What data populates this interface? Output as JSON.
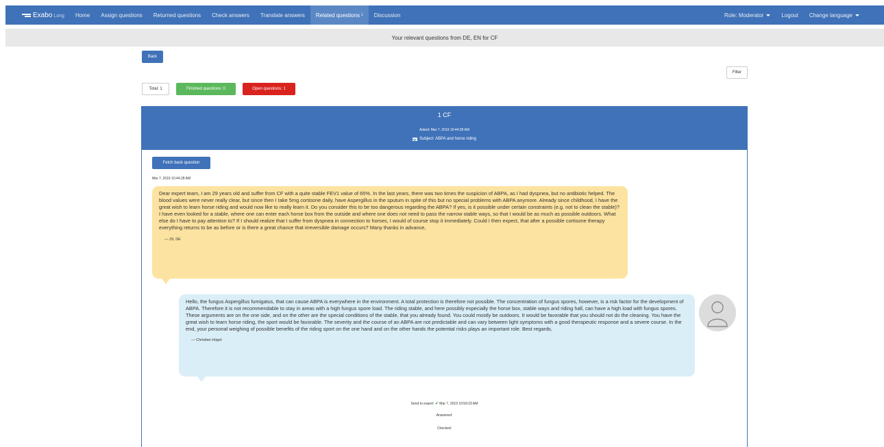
{
  "navbar": {
    "brand": "Exabo",
    "brand_sub": "Long",
    "items": [
      {
        "label": "Home"
      },
      {
        "label": "Assign questions"
      },
      {
        "label": "Returned questions"
      },
      {
        "label": "Check answers"
      },
      {
        "label": "Translate answers"
      },
      {
        "label": "Related questions",
        "badge": "1"
      },
      {
        "label": "Discussion"
      }
    ],
    "role": "Role: Moderator",
    "logout": "Logout",
    "change_language": "Change language"
  },
  "subheader": "Your relevant questions from DE, EN for CF",
  "buttons": {
    "back": "Back",
    "filter": "Filter",
    "fetch_back": "Fetch back question"
  },
  "stats": {
    "total": "Total: 1",
    "finished": "Finished questions: 0",
    "open": "Open questions: 1"
  },
  "panel": {
    "title": "1 CF",
    "asked": "Asked: Mar 7, 2019 10:44:28 AM",
    "subject": "Subject: ABPA and horse riding"
  },
  "question": {
    "timestamp": "Mar 7, 2019 10:44:28 AM",
    "text": "Dear expert team, I am 29 years old and suffer from CF with a quite stable FEV1 value of 65%. In the last years, there was two times the suspicion of ABPA, as I had dyspnea, but no antibiotic helped. The blood values were never really clear, but since then I take 5mg cortisone daily, have Aspergillus in the sputum in spite of this but no special problems with ABPA anymore. Already since childhood, I have the great wish to learn horse riding and would now like to really learn it. Do you consider this to be too dangerous regarding the ABPA? If yes, is it possible under certain constraints (e.g. not to clean the stable)? I have even looked for a stable, where one can enter each horse box from the outside and where one does not need to pass the narrow stable ways, so that I would be as much as possible outdoors. What else do I have to pay attention to? If I should realize that I suffer from dyspnea in connection to horses, I would of course stop it immediately. Could I then expect, that after a possible cortisone therapy everything returns to be as before or is there a great chance that irreversible damage occurs? Many thanks in advance,",
    "author": "— 29, DE"
  },
  "answer": {
    "text": "Hello, the fungus Aspergillus fumigatus, that can cause ABPA is everywhere in the environment. A total protection is therefore not possible. The concentration of fungus spores, however, is a risk factor for the development of ABPA. Therefore it is not recommendable to stay in areas with a high fungus spore load. The riding stable, and here possibly especially the horse box, stable ways and riding hall, can have a high load with fungus spores. These arguments are on the one side, and on the other are the special conditions of the stable, that you already found. You could mostly be outdoors. It would be favorable that you should not do the cleaning. You have the great wish to learn horse riding, the sport would be favorable. The severity and the course of an ABPA are not predictable and can vary between light symptoms with a good therapeutic response and a severe course. In the end, your personal weighing of possible benefits of the riding sport on the one hand and on the other hands the potential risks plays an important role. Best regards,",
    "author": "— Christian Hügel"
  },
  "meta": {
    "send_label": "Send to expert:",
    "send_date": "Mar 7, 2019 10:59:23 AM",
    "answered": "Answered:",
    "checked": "Checked:"
  },
  "colors": {
    "primary": "#3f72b8",
    "success": "#5cb85c",
    "danger": "#d9231e",
    "question_bubble": "#fde3a1",
    "answer_bubble": "#daeef7"
  },
  "icons": [
    "brand-logo-icon",
    "caret-down-icon",
    "envelope-icon",
    "avatar-icon",
    "check-icon"
  ]
}
